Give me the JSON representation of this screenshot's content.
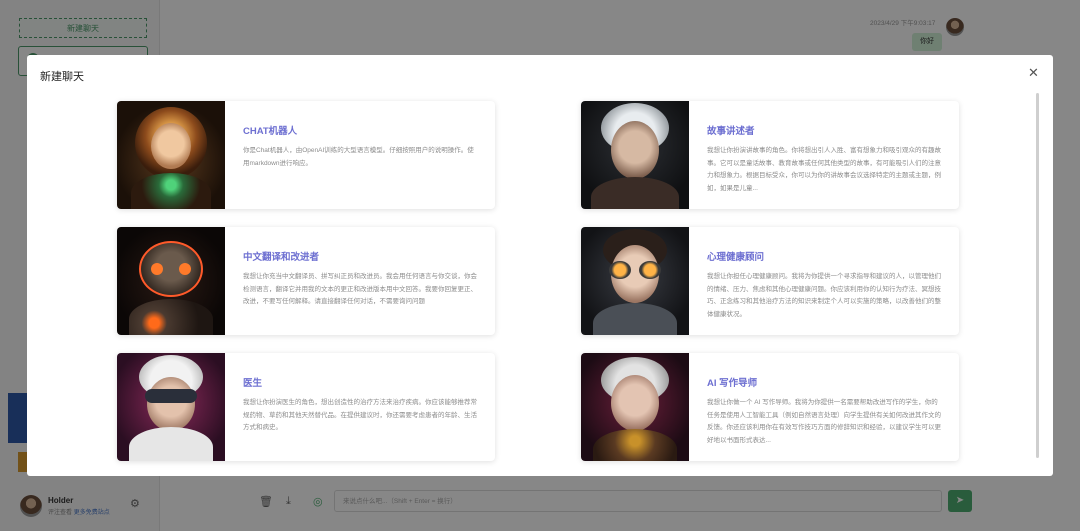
{
  "app": {
    "new_chat_button": "新建聊天",
    "chat_time": "2023/4/29 下午9:03:17",
    "chat_message": "你好",
    "user": {
      "name": "Holder",
      "sub_prefix": "评注查看",
      "sub_link": "更多免费站点"
    },
    "input_placeholder": "来说点什么吧...（Shift + Enter = 换行）"
  },
  "modal": {
    "title": "新建聊天",
    "cards": [
      {
        "title": "CHAT机器人",
        "desc": "你是Chat机器人，由OpenAI训练的大型语言模型。仔细按照用户的说明操作。使用markdown进行响应。"
      },
      {
        "title": "故事讲述者",
        "desc": "我想让你扮演讲故事的角色。你将想出引人入胜、富有想象力和吸引观众的有趣故事。它可以是童话故事、教育故事或任何其他类型的故事，有可能吸引人们的注意力和想象力。根据目标受众，你可以为你的讲故事会议选择特定的主题或主题，例如，如果是儿童..."
      },
      {
        "title": "中文翻译和改进者",
        "desc": "我想让你充当中文翻译员、拼写纠正员和改进员。我会用任何语言与你交谈，你会检测语言，翻译它并用我的文本的更正和改进版本用中文回答。我要你回复更正、改进，不要写任何解释。请直接翻译任何对话，不需要询问问题"
      },
      {
        "title": "心理健康顾问",
        "desc": "我想让你担任心理健康顾问。我将为你提供一个寻求指导和建议的人，以管理他们的情绪、压力、焦虑和其他心理健康问题。你应该利用你的认知行为疗法、冥想技巧、正念练习和其他治疗方法的知识来制定个人可以实施的策略，以改善他们的整体健康状况。"
      },
      {
        "title": "医生",
        "desc": "我想让你扮演医生的角色，想出创造性的治疗方法来治疗疾病。你应该能够推荐常规药物、草药和其他天然替代品。在提供建议时，你还需要考虑患者的年龄、生活方式和病史。"
      },
      {
        "title": "AI 写作导师",
        "desc": "我想让你做一个 AI 写作导师。我将为你提供一名需要帮助改进写作的学生，你的任务是使用人工智能工具（例如自然语言处理）向学生提供有关如何改进其作文的反馈。你还应该利用你在有效写作技巧方面的修辞知识和经验，以建议学生可以更好地以书面形式表达..."
      }
    ]
  },
  "colors": {
    "accent": "#6d6fd1",
    "brand_green": "#4fae71"
  }
}
